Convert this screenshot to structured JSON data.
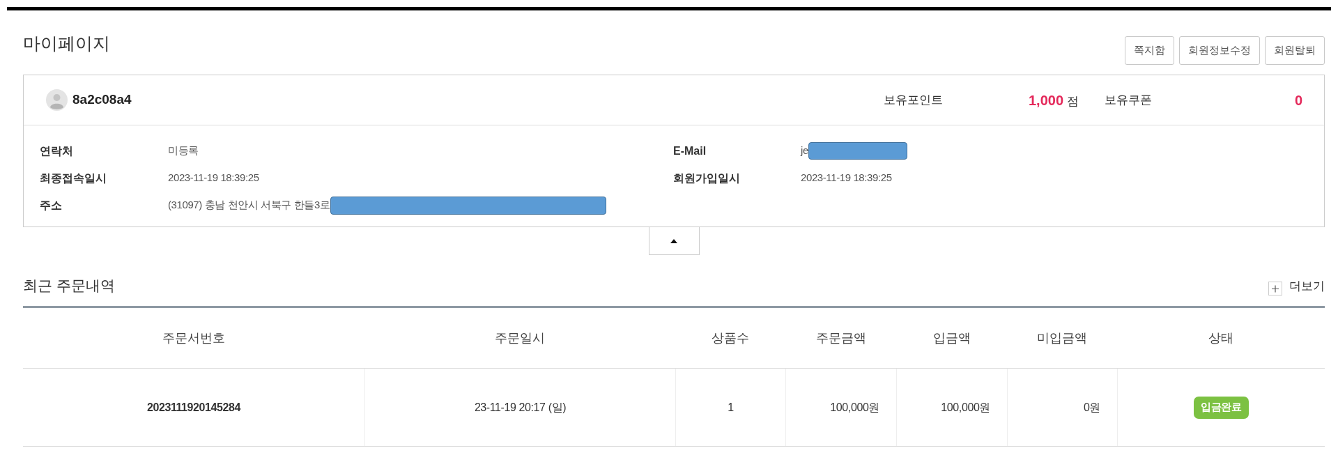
{
  "title": "마이페이지",
  "actions": [
    "쪽지함",
    "회원정보수정",
    "회원탈퇴"
  ],
  "member": {
    "username": "8a2c08a4",
    "points": {
      "label": "보유포인트",
      "value": "1,000",
      "unit": "점"
    },
    "coupons": {
      "label": "보유쿠폰",
      "value": "0"
    },
    "info_left": [
      {
        "label": "연락처",
        "value": "미등록",
        "redacted": false
      },
      {
        "label": "최종접속일시",
        "value": "2023-11-19 18:39:25",
        "redacted": false
      },
      {
        "label": "주소",
        "value": "(31097) 충남 천안시 서북구 한들3로",
        "redacted": true
      }
    ],
    "info_right": [
      {
        "label": "E-Mail",
        "value": "je",
        "redacted": true
      },
      {
        "label": "회원가입일시",
        "value": "2023-11-19 18:39:25",
        "redacted": false
      }
    ]
  },
  "details_toggle": {
    "expanded": true
  },
  "recent_orders": {
    "title": "최근 주문내역",
    "more_link": "더보기",
    "columns": [
      {
        "label": "주문서번호",
        "kind": "number"
      },
      {
        "label": "주문일시",
        "kind": "text"
      },
      {
        "label": "상품수",
        "kind": "text"
      },
      {
        "label": "주문금액",
        "kind": "amount"
      },
      {
        "label": "입금액",
        "kind": "amount"
      },
      {
        "label": "미입금액",
        "kind": "amount"
      },
      {
        "label": "상태",
        "kind": "status"
      }
    ],
    "rows": [
      {
        "cells": [
          "2023111920145284",
          "23-11-19 20:17 (일)",
          "1",
          "100,000원",
          "100,000원",
          "0원",
          "입금완료"
        ]
      }
    ]
  }
}
